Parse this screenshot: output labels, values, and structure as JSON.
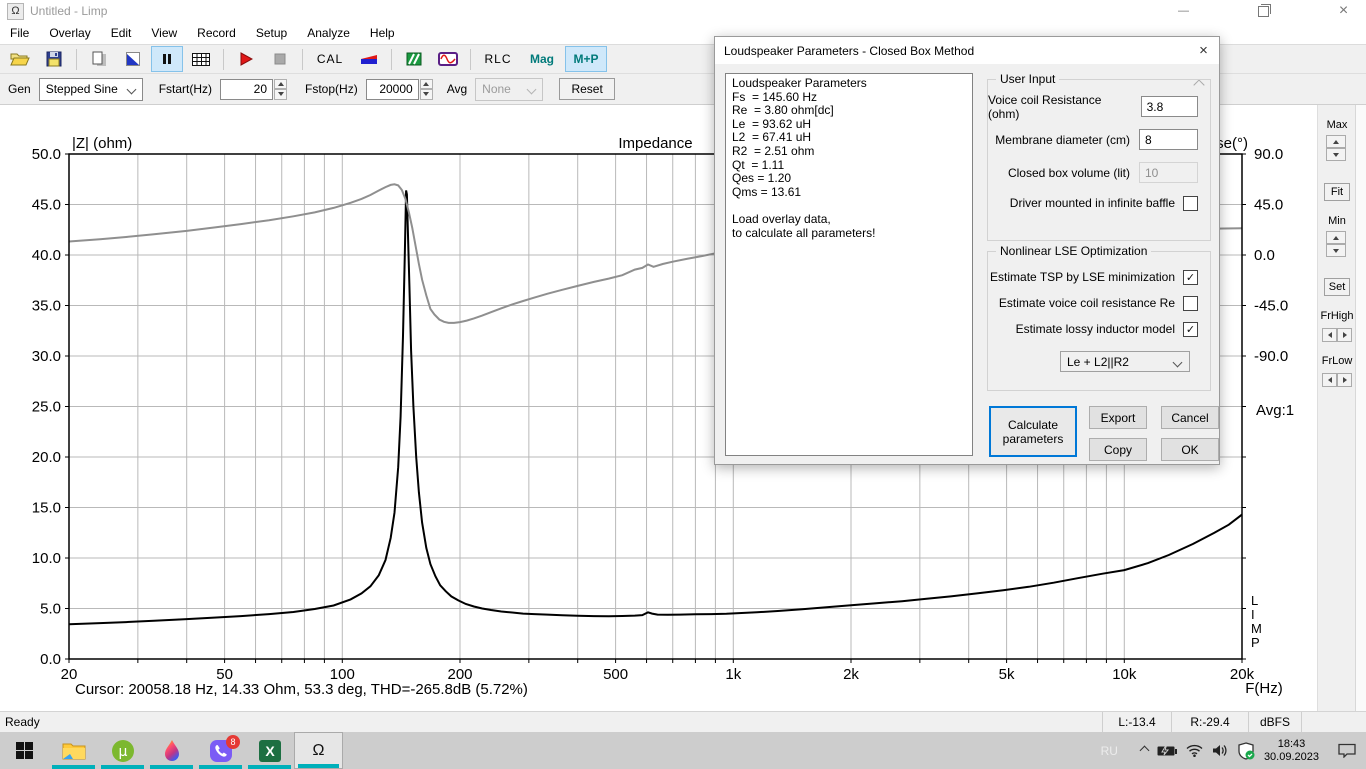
{
  "titlebar": {
    "title": "Untitled - Limp"
  },
  "glyphs": {
    "check": "✓",
    "close": "×",
    "minimize": "—",
    "omega": "Ω",
    "micro": "µ",
    "excel_x": "X"
  },
  "menu": {
    "items": [
      "File",
      "Overlay",
      "Edit",
      "View",
      "Record",
      "Setup",
      "Analyze",
      "Help"
    ]
  },
  "toolbar": {
    "cal": "CAL",
    "rlc": "RLC",
    "mag": "Mag",
    "mp": "M+P"
  },
  "controls": {
    "gen_label": "Gen",
    "gen_value": "Stepped Sine",
    "fstart_label": "Fstart(Hz)",
    "fstart_value": "20",
    "fstop_label": "Fstop(Hz)",
    "fstop_value": "20000",
    "avg_label": "Avg",
    "avg_value": "None",
    "reset": "Reset"
  },
  "side_panel": {
    "max": "Max",
    "fit": "Fit",
    "min": "Min",
    "set": "Set",
    "frhigh": "FrHigh",
    "frlow": "FrLow"
  },
  "cursor_readout": "Cursor: 20058.18 Hz, 14.33 Ohm, 53.3 deg, THD=-265.8dB (5.72%)",
  "chart_data": {
    "type": "line",
    "title": "Impedance",
    "ylabel_left": "|Z| (ohm)",
    "ylabel_right": "Phase(°)",
    "xlabel": "F(Hz)",
    "x_scale": "log",
    "x_range": [
      20,
      20000
    ],
    "y_left_range": [
      0,
      50
    ],
    "y_left_tick_step": 5,
    "y_left_tick_labels": [
      "0.0",
      "5.0",
      "10.0",
      "15.0",
      "20.0",
      "25.0",
      "30.0",
      "35.0",
      "40.0",
      "45.0",
      "50.0"
    ],
    "x_gridlines": [
      20,
      30,
      40,
      50,
      60,
      70,
      80,
      90,
      100,
      200,
      300,
      400,
      500,
      600,
      700,
      800,
      900,
      1000,
      2000,
      3000,
      4000,
      5000,
      6000,
      7000,
      8000,
      9000,
      10000,
      20000
    ],
    "x_tick_labels": [
      [
        20,
        "20"
      ],
      [
        50,
        "50"
      ],
      [
        100,
        "100"
      ],
      [
        200,
        "200"
      ],
      [
        500,
        "500"
      ],
      [
        1000,
        "1k"
      ],
      [
        2000,
        "2k"
      ],
      [
        5000,
        "5k"
      ],
      [
        10000,
        "10k"
      ],
      [
        20000,
        "20k"
      ]
    ],
    "phase_ticks": [
      [
        90,
        "90.0"
      ],
      [
        45,
        "45.0"
      ],
      [
        0,
        "0.0"
      ],
      [
        -45,
        "-45.0"
      ],
      [
        -90,
        "-90.0"
      ]
    ],
    "phase_mapping": {
      "left_value_at_zero_deg": 40,
      "deg_per_left_unit": 9
    },
    "grid_color": "#b9b9b9",
    "frame_color": "#000000",
    "avg_annotation": "Avg:1",
    "watermark": "LIMP",
    "legend_position": "none",
    "series": [
      {
        "name": "impedance-magnitude",
        "axis": "left",
        "color": "#000000",
        "width": 2,
        "points": [
          [
            20,
            3.45
          ],
          [
            24,
            3.55
          ],
          [
            28,
            3.65
          ],
          [
            33,
            3.78
          ],
          [
            40,
            3.95
          ],
          [
            47,
            4.1
          ],
          [
            55,
            4.25
          ],
          [
            65,
            4.45
          ],
          [
            75,
            4.65
          ],
          [
            85,
            4.95
          ],
          [
            95,
            5.3
          ],
          [
            105,
            5.9
          ],
          [
            112,
            6.5
          ],
          [
            118,
            7.2
          ],
          [
            124,
            8.3
          ],
          [
            129,
            9.8
          ],
          [
            133,
            12
          ],
          [
            136,
            14.5
          ],
          [
            139,
            19
          ],
          [
            141,
            24
          ],
          [
            143,
            32
          ],
          [
            144.5,
            40
          ],
          [
            145.6,
            46.4
          ],
          [
            146.3,
            46
          ],
          [
            147,
            43
          ],
          [
            148.5,
            37
          ],
          [
            150,
            30.5
          ],
          [
            152,
            25
          ],
          [
            154.5,
            20
          ],
          [
            157,
            16.5
          ],
          [
            160,
            13.5
          ],
          [
            164,
            11
          ],
          [
            168,
            9.4
          ],
          [
            173,
            8.2
          ],
          [
            178,
            7.3
          ],
          [
            184,
            6.7
          ],
          [
            190,
            6.2
          ],
          [
            198,
            5.8
          ],
          [
            207,
            5.45
          ],
          [
            217,
            5.2
          ],
          [
            228,
            5
          ],
          [
            240,
            4.85
          ],
          [
            255,
            4.7
          ],
          [
            272,
            4.6
          ],
          [
            290,
            4.5
          ],
          [
            310,
            4.45
          ],
          [
            335,
            4.4
          ],
          [
            365,
            4.33
          ],
          [
            400,
            4.28
          ],
          [
            440,
            4.25
          ],
          [
            480,
            4.24
          ],
          [
            520,
            4.26
          ],
          [
            560,
            4.3
          ],
          [
            585,
            4.35
          ],
          [
            605,
            4.62
          ],
          [
            620,
            4.5
          ],
          [
            640,
            4.4
          ],
          [
            680,
            4.38
          ],
          [
            730,
            4.4
          ],
          [
            800,
            4.43
          ],
          [
            880,
            4.45
          ],
          [
            960,
            4.48
          ],
          [
            1050,
            4.55
          ],
          [
            1150,
            4.62
          ],
          [
            1300,
            4.75
          ],
          [
            1500,
            4.92
          ],
          [
            1700,
            5.1
          ],
          [
            2000,
            5.32
          ],
          [
            2300,
            5.5
          ],
          [
            2700,
            5.72
          ],
          [
            3100,
            5.95
          ],
          [
            3600,
            6.2
          ],
          [
            4200,
            6.5
          ],
          [
            4900,
            6.8
          ],
          [
            5700,
            7.15
          ],
          [
            6600,
            7.55
          ],
          [
            7600,
            8
          ],
          [
            8800,
            8.45
          ],
          [
            10000,
            8.8
          ],
          [
            11500,
            9.5
          ],
          [
            13000,
            10.3
          ],
          [
            15000,
            11.4
          ],
          [
            17000,
            12.5
          ],
          [
            18500,
            13.3
          ],
          [
            20000,
            14.3
          ]
        ]
      },
      {
        "name": "impedance-phase",
        "axis": "phase",
        "color": "#8f8f8f",
        "width": 2,
        "points": [
          [
            20,
            12
          ],
          [
            24,
            14
          ],
          [
            28,
            16
          ],
          [
            33,
            18.5
          ],
          [
            40,
            21.5
          ],
          [
            47,
            24.5
          ],
          [
            55,
            27.5
          ],
          [
            65,
            31
          ],
          [
            75,
            34.5
          ],
          [
            85,
            38
          ],
          [
            95,
            42
          ],
          [
            105,
            46.5
          ],
          [
            112,
            50
          ],
          [
            118,
            53.5
          ],
          [
            124,
            57.5
          ],
          [
            129,
            60.5
          ],
          [
            133,
            62.5
          ],
          [
            136,
            63
          ],
          [
            139,
            62
          ],
          [
            142,
            58
          ],
          [
            145,
            50
          ],
          [
            148,
            38
          ],
          [
            151,
            24
          ],
          [
            154,
            8
          ],
          [
            157,
            -8
          ],
          [
            160,
            -22
          ],
          [
            164,
            -36
          ],
          [
            168,
            -48
          ],
          [
            172,
            -53
          ],
          [
            177,
            -57.5
          ],
          [
            182,
            -59.5
          ],
          [
            187,
            -60.5
          ],
          [
            193,
            -60.5
          ],
          [
            200,
            -59.8
          ],
          [
            208,
            -58.5
          ],
          [
            217,
            -56.5
          ],
          [
            228,
            -54
          ],
          [
            240,
            -51
          ],
          [
            255,
            -47.5
          ],
          [
            272,
            -44
          ],
          [
            290,
            -41
          ],
          [
            310,
            -38
          ],
          [
            335,
            -34.5
          ],
          [
            365,
            -31
          ],
          [
            400,
            -27.5
          ],
          [
            440,
            -24
          ],
          [
            480,
            -21
          ],
          [
            520,
            -18
          ],
          [
            560,
            -13
          ],
          [
            585,
            -11.5
          ],
          [
            605,
            -8.5
          ],
          [
            625,
            -10.5
          ],
          [
            660,
            -8
          ],
          [
            700,
            -6
          ],
          [
            760,
            -3.5
          ],
          [
            830,
            -1
          ],
          [
            900,
            1.5
          ],
          [
            1000,
            4
          ],
          [
            1100,
            6
          ],
          [
            1250,
            8.5
          ],
          [
            1450,
            11
          ],
          [
            1700,
            13
          ],
          [
            2000,
            14.8
          ],
          [
            2400,
            16.4
          ],
          [
            2900,
            17.8
          ],
          [
            3500,
            18.9
          ],
          [
            4200,
            19.7
          ],
          [
            5000,
            20.3
          ],
          [
            6000,
            20.9
          ],
          [
            7000,
            21.3
          ],
          [
            8000,
            21.7
          ],
          [
            8600,
            22.8
          ],
          [
            9200,
            21.8
          ],
          [
            10000,
            22.1
          ],
          [
            11500,
            22.5
          ],
          [
            13500,
            22.9
          ],
          [
            16000,
            23.3
          ],
          [
            18000,
            23.6
          ],
          [
            20000,
            23.8
          ]
        ]
      }
    ]
  },
  "dialog": {
    "title": "Loudspeaker Parameters - Closed Box Method",
    "params_text": "Loudspeaker Parameters\nFs  = 145.60 Hz\nRe  = 3.80 ohm[dc]\nLe  = 93.62 uH\nL2  = 67.41 uH\nR2  = 2.51 ohm\nQt  = 1.11\nQes = 1.20\nQms = 13.61\n\nLoad overlay data,\nto calculate all parameters!",
    "user_input": {
      "legend": "User Input",
      "fields": [
        {
          "label": "Voice coil Resistance (ohm)",
          "value": "3.8"
        },
        {
          "label": "Membrane diameter (cm)",
          "value": "8"
        },
        {
          "label": "Closed box volume (lit)",
          "value": "10"
        }
      ],
      "baffle_checkbox": {
        "label": "Driver mounted in infinite baffle",
        "checked": false
      }
    },
    "optimization": {
      "legend": "Nonlinear LSE Optimization",
      "checkboxes": [
        {
          "label": "Estimate TSP by LSE minimization",
          "checked": true
        },
        {
          "label": "Estimate voice coil resistance Re",
          "checked": false
        },
        {
          "label": "Estimate lossy inductor model",
          "checked": true
        }
      ],
      "dropdown_value": "Le + L2||R2"
    },
    "buttons": {
      "calculate": "Calculate parameters",
      "export": "Export",
      "cancel": "Cancel",
      "copy": "Copy",
      "ok": "OK"
    }
  },
  "status_bar": {
    "ready": "Ready",
    "left_level": "L:-13.4",
    "right_level": "R:-29.4",
    "unit": "dBFS"
  },
  "taskbar": {
    "language": "RU",
    "time": "18:43",
    "date": "30.09.2023",
    "viber_badge": "8"
  }
}
